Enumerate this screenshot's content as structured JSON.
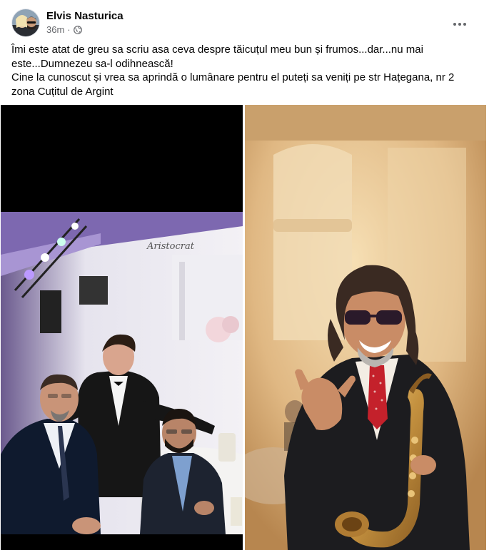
{
  "post": {
    "author": "Elvis Nasturica",
    "time": "36m",
    "separator": "·",
    "audience_icon": "globe-icon",
    "more_icon": "more-horizontal-icon",
    "text_lines": [
      "Îmi este atat de greu sa scriu asa ceva despre tăicuțul meu bun și frumos...dar...nu mai",
      "este...Dumnezeu sa-l odihnească!",
      "Cine la cunoscut și vrea sa aprindă o lumânare pentru el puteți sa veniți pe str Hațegana, nr 2",
      "zona Cuțitul de Argint"
    ]
  },
  "photos": [
    {
      "name": "group-photo",
      "alt_icon": "photo"
    },
    {
      "name": "saxophonist-photo",
      "alt_icon": "photo"
    }
  ],
  "colors": {
    "text": "#050505",
    "meta": "#65676b",
    "background": "#ffffff"
  }
}
